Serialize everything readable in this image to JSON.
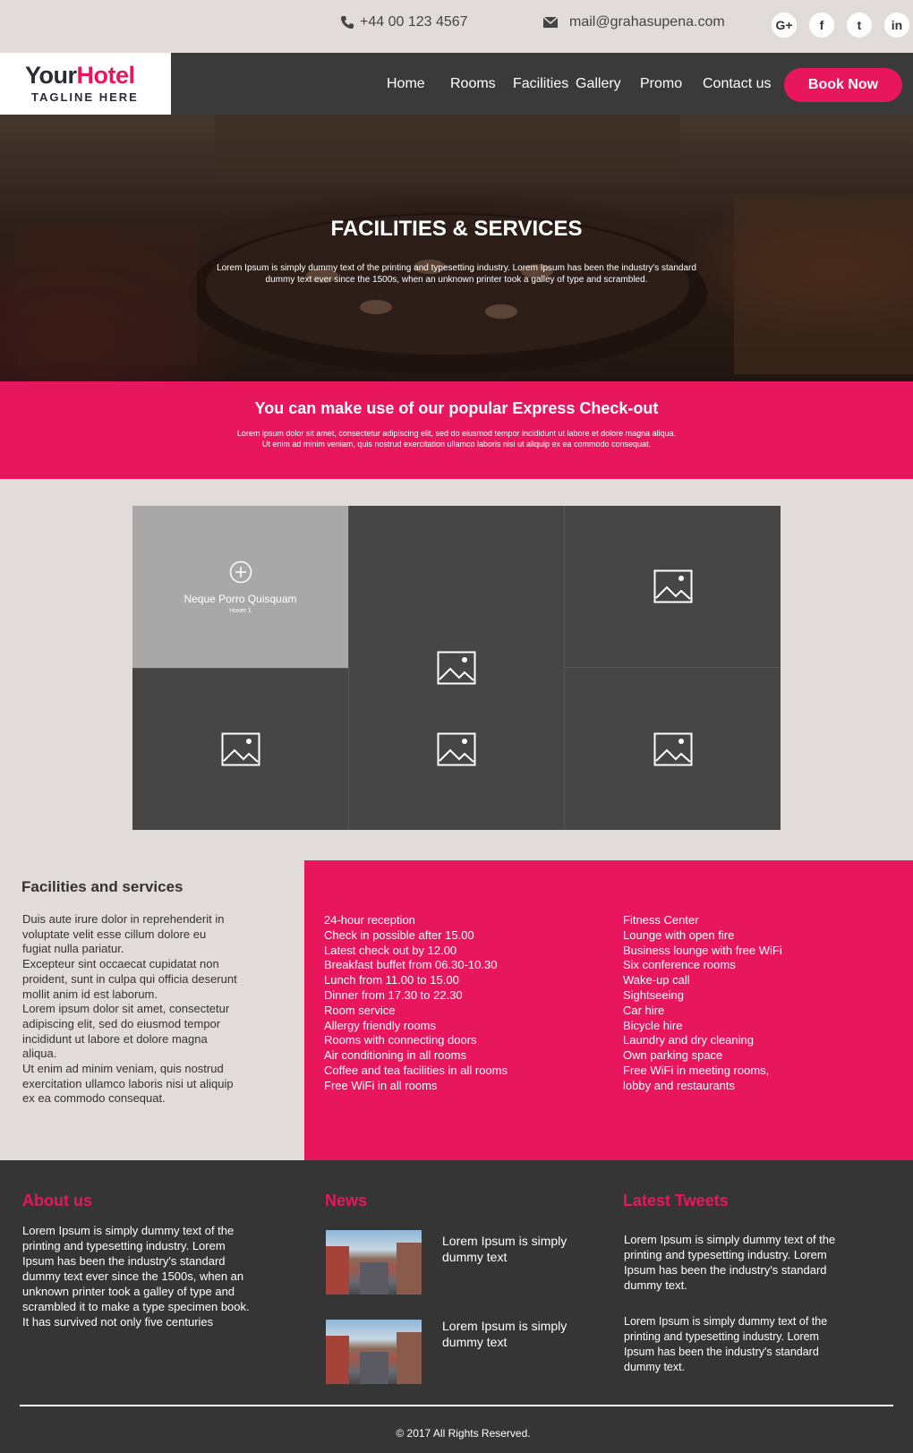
{
  "topbar": {
    "phone": "+44 00 123 4567",
    "email": "mail@grahasupena.com",
    "socials": [
      {
        "label": "G+",
        "icon": "google-plus-icon"
      },
      {
        "label": "f",
        "icon": "facebook-icon"
      },
      {
        "label": "t",
        "icon": "twitter-icon"
      },
      {
        "label": "in",
        "icon": "linkedin-icon"
      }
    ]
  },
  "logo": {
    "name_part1": "Your",
    "name_part2": "Hotel",
    "tagline": "TAGLINE HERE"
  },
  "nav": {
    "items": [
      "Home",
      "Rooms",
      "Facilities",
      "Gallery",
      "Promo",
      "Contact us"
    ],
    "cta": "Book Now"
  },
  "hero": {
    "title": "FACILITIES & SERVICES",
    "text": "Lorem Ipsum is simply dummy text of the printing and typesetting industry. Lorem Ipsum has been the industry's standard dummy text ever since the 1500s, when an unknown printer took a galley of type and scrambled."
  },
  "band": {
    "title": "You can make use of our popular Express Check-out",
    "text": "Lorem ipsum dolor sit amet, consectetur adipiscing elit, sed do eiusmod tempor incididunt ut labore et dolore magna aliqua. Ut enim ad minim veniam, quis nostrud exercitation ullamco laboris nisi ut aliquip ex ea commodo consequat."
  },
  "gallery": {
    "hover_title": "Neque Porro Quisquam",
    "hover_sub": "Hover 1"
  },
  "facilities": {
    "heading": "Facilities and services",
    "paragraphs": [
      "Duis aute irure dolor in reprehenderit in voluptate velit esse cillum dolore eu fugiat nulla pariatur.",
      "Excepteur sint occaecat cupidatat non proident, sunt in culpa qui officia deserunt mollit anim id est laborum.",
      "Lorem ipsum dolor sit amet, consectetur adipiscing elit, sed do eiusmod tempor incididunt ut labore et dolore magna aliqua.",
      "Ut enim ad minim veniam, quis nostrud exercitation ullamco laboris nisi ut aliquip ex ea commodo consequat."
    ],
    "list_col1": [
      "24-hour reception",
      "Check in possible after 15.00",
      "Latest check out by 12.00",
      "Breakfast buffet from 06.30-10.30",
      "Lunch from 11.00 to 15.00",
      "Dinner from 17.30 to 22.30",
      "Room service",
      "Allergy friendly rooms",
      "Rooms with connecting doors",
      "Air conditioning in all rooms",
      "Coffee and tea facilities in all rooms",
      "Free WiFi in all rooms"
    ],
    "list_col2": [
      "Fitness Center",
      "Lounge with open fire",
      "Business lounge with free WiFi",
      "Six conference rooms",
      "Wake-up call",
      "Sightseeing",
      "Car hire",
      "Bicycle hire",
      "Laundry and dry cleaning",
      "Own parking space",
      "Free WiFi in meeting rooms, lobby and restaurants"
    ]
  },
  "footer": {
    "about_heading": "About us",
    "about_text": "Lorem Ipsum is simply dummy text of the printing and typesetting industry. Lorem Ipsum has been the industry's standard dummy text ever since the 1500s, when an unknown printer took a galley of type and scrambled it to make a type specimen book. It has survived not only five centuries",
    "news_heading": "News",
    "news": [
      {
        "title": "Lorem Ipsum is simply dummy text"
      },
      {
        "title": "Lorem Ipsum is simply dummy text"
      }
    ],
    "tweets_heading": "Latest Tweets",
    "tweets": [
      "Lorem Ipsum is simply dummy text of the printing and typesetting industry. Lorem Ipsum has been the industry's standard dummy text.",
      "Lorem Ipsum is simply dummy text of the printing and typesetting industry. Lorem Ipsum has been the industry's standard dummy text."
    ],
    "copyright": "© 2017 All Rights Reserved."
  },
  "colors": {
    "accent": "#e8175d",
    "dark": "#3a3a3a",
    "footer": "#353535",
    "background": "#e1dcd9"
  }
}
